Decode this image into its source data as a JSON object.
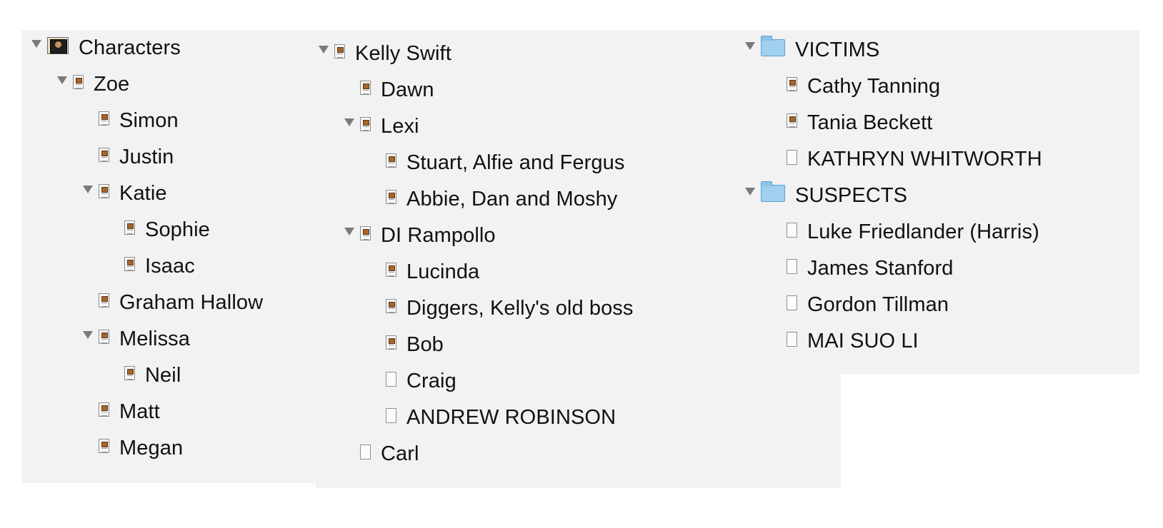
{
  "panels": {
    "left": {
      "items": [
        {
          "label": "Characters",
          "icon": "character-sheet-root-icon",
          "expanded": true,
          "depth": 0
        },
        {
          "label": "Zoe",
          "icon": "character-sheet-icon",
          "expanded": true,
          "depth": 1
        },
        {
          "label": "Simon",
          "icon": "character-sheet-icon",
          "depth": 2
        },
        {
          "label": "Justin",
          "icon": "character-sheet-icon",
          "depth": 2
        },
        {
          "label": "Katie",
          "icon": "character-sheet-icon",
          "expanded": true,
          "depth": 2
        },
        {
          "label": "Sophie",
          "icon": "character-sheet-icon",
          "depth": 3
        },
        {
          "label": "Isaac",
          "icon": "character-sheet-icon",
          "depth": 3
        },
        {
          "label": "Graham Hallow",
          "icon": "character-sheet-icon",
          "depth": 2
        },
        {
          "label": "Melissa",
          "icon": "character-sheet-icon",
          "expanded": true,
          "depth": 2
        },
        {
          "label": "Neil",
          "icon": "character-sheet-icon",
          "depth": 3
        },
        {
          "label": "Matt",
          "icon": "character-sheet-icon",
          "depth": 2
        },
        {
          "label": "Megan",
          "icon": "character-sheet-icon",
          "depth": 2
        }
      ]
    },
    "middle": {
      "items": [
        {
          "label": "Kelly Swift",
          "icon": "character-sheet-icon",
          "expanded": true,
          "depth": 0
        },
        {
          "label": "Dawn",
          "icon": "character-sheet-icon",
          "depth": 1
        },
        {
          "label": "Lexi",
          "icon": "character-sheet-icon",
          "expanded": true,
          "depth": 1
        },
        {
          "label": "Stuart, Alfie and Fergus",
          "icon": "character-sheet-icon",
          "depth": 2
        },
        {
          "label": "Abbie, Dan and Moshy",
          "icon": "character-sheet-icon",
          "depth": 2
        },
        {
          "label": "DI Rampollo",
          "icon": "character-sheet-icon",
          "expanded": true,
          "depth": 1
        },
        {
          "label": "Lucinda",
          "icon": "character-sheet-icon",
          "depth": 2
        },
        {
          "label": "Diggers, Kelly's old boss",
          "icon": "character-sheet-icon",
          "depth": 2
        },
        {
          "label": "Bob",
          "icon": "character-sheet-icon",
          "depth": 2
        },
        {
          "label": "Craig",
          "icon": "blank-document-icon",
          "depth": 2
        },
        {
          "label": "ANDREW ROBINSON",
          "icon": "blank-document-icon",
          "depth": 2
        },
        {
          "label": "Carl",
          "icon": "blank-document-icon",
          "depth": 1
        }
      ]
    },
    "right": {
      "items": [
        {
          "label": "VICTIMS",
          "icon": "folder-icon",
          "expanded": true,
          "depth": 0
        },
        {
          "label": "Cathy Tanning",
          "icon": "character-sheet-icon",
          "depth": 1
        },
        {
          "label": "Tania Beckett",
          "icon": "character-sheet-icon",
          "depth": 1
        },
        {
          "label": "KATHRYN WHITWORTH",
          "icon": "blank-document-icon",
          "depth": 1
        },
        {
          "label": "SUSPECTS",
          "icon": "folder-icon",
          "expanded": true,
          "depth": 0
        },
        {
          "label": "Luke Friedlander (Harris)",
          "icon": "blank-document-icon",
          "depth": 1
        },
        {
          "label": "James Stanford",
          "icon": "blank-document-icon",
          "depth": 1
        },
        {
          "label": "Gordon Tillman",
          "icon": "blank-document-icon",
          "depth": 1
        },
        {
          "label": "MAI SUO LI",
          "icon": "blank-document-icon",
          "depth": 1
        }
      ]
    }
  },
  "colors": {
    "panel_background": "#f2f2f2",
    "disclosure_triangle": "#7a7a7a",
    "folder": "#9fd0ef",
    "text": "#111111"
  }
}
